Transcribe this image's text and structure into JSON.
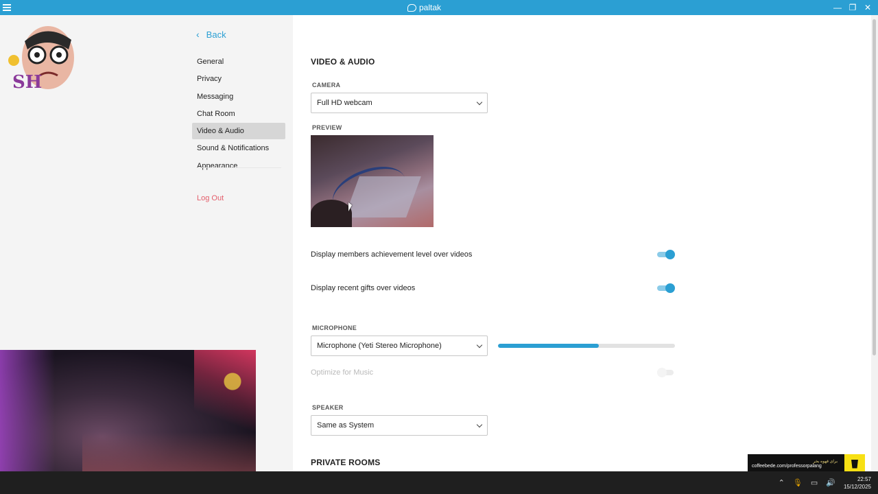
{
  "window": {
    "app_name": "paltak",
    "controls": [
      "—",
      "❐",
      "✕"
    ]
  },
  "sidebar": {
    "back_label": "Back",
    "items": [
      {
        "label": "General",
        "active": false
      },
      {
        "label": "Privacy",
        "active": false
      },
      {
        "label": "Messaging",
        "active": false
      },
      {
        "label": "Chat Room",
        "active": false
      },
      {
        "label": "Video & Audio",
        "active": true
      },
      {
        "label": "Sound & Notifications",
        "active": false
      },
      {
        "label": "Appearance",
        "active": false
      }
    ],
    "logout_label": "Log Out"
  },
  "main": {
    "section_title": "VIDEO & AUDIO",
    "camera": {
      "label": "CAMERA",
      "value": "Full HD webcam"
    },
    "preview_label": "PREVIEW",
    "settings": [
      {
        "label": "Display members achievement level over videos",
        "enabled": true
      },
      {
        "label": "Display recent gifts over videos",
        "enabled": true
      }
    ],
    "microphone": {
      "label": "MICROPHONE",
      "value": "Microphone (Yeti Stereo Microphone)",
      "level_percent": 57,
      "optimize_label": "Optimize for Music",
      "optimize_enabled": false
    },
    "speaker": {
      "label": "SPEAKER",
      "value": "Same as System"
    },
    "private_rooms_title": "PRIVATE ROOMS"
  },
  "promo": {
    "title": "برای قهوه بخر",
    "url": "coffeebede.com/professorpalang"
  },
  "taskbar": {
    "time": "22:57",
    "date": "15/12/2025"
  },
  "colors": {
    "accent": "#2b9fd3",
    "logout": "#e35d6a",
    "sidebar_bg": "#f4f4f4"
  }
}
